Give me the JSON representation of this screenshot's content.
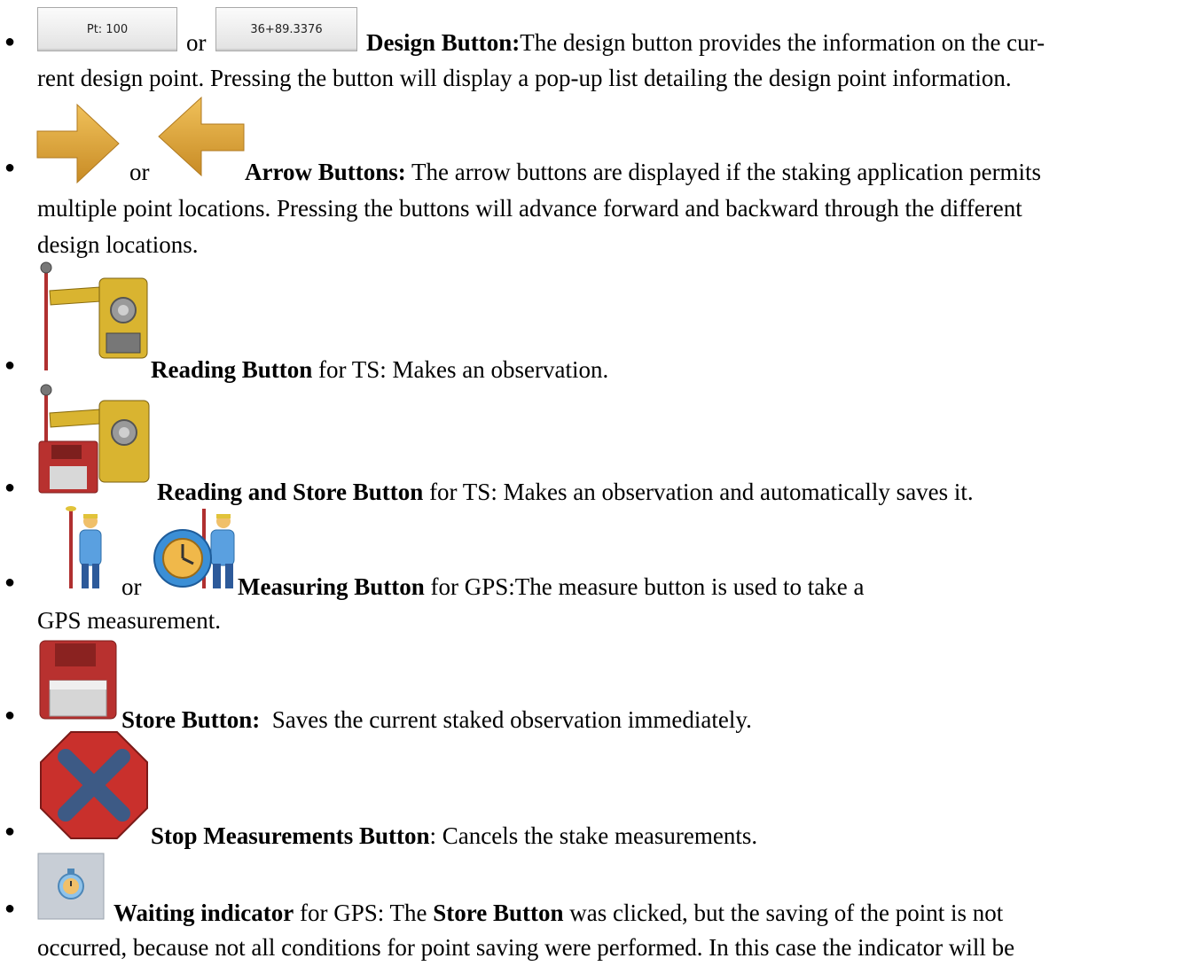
{
  "items": [
    {
      "btn1_label": "Pt: 100",
      "or": "or",
      "btn2_label": "36+89.3376",
      "title": "Design Button:",
      "desc_line1": "The design button provides the information on the cur-",
      "desc_line2": "rent design point. Pressing the button will display a pop-up list detailing the design point information.",
      "icons": [
        "design-button-pt",
        "design-button-station"
      ]
    },
    {
      "or": "or",
      "title": "Arrow Buttons:",
      "desc_line1": " The arrow buttons are displayed if the staking application permits",
      "desc_line2": "multiple point locations. Pressing the buttons will advance forward and backward through the different",
      "desc_line3": "design locations.",
      "icons": [
        "arrow-right-icon",
        "arrow-left-icon"
      ]
    },
    {
      "title": "Reading Button",
      "desc": " for TS: Makes an observation.",
      "icons": [
        "total-station-reading-icon"
      ]
    },
    {
      "title": "Reading and Store Button",
      "desc": " for TS: Makes an observation and automatically saves it.",
      "icons": [
        "total-station-store-icon"
      ]
    },
    {
      "or": "or",
      "title": "Measuring Button",
      "desc_line1": " for GPS:The measure button is used to take a",
      "desc_line2": "GPS measurement.",
      "icons": [
        "gps-surveyor-icon",
        "gps-timer-surveyor-icon"
      ]
    },
    {
      "title": "Store Button:",
      "desc": "  Saves the current staked observation immediately.",
      "icons": [
        "floppy-disk-icon"
      ]
    },
    {
      "title": "Stop Measurements Button",
      "desc": ": Cancels the stake measurements.",
      "icons": [
        "stop-x-icon"
      ]
    },
    {
      "title": "Waiting indicator",
      "desc_a": " for GPS: The ",
      "inline_bold": "Store Button",
      "desc_b": " was clicked, but the saving of the point is not",
      "desc_line2": "occurred, because not all conditions for point saving were performed. In this case the indicator will be",
      "icons": [
        "waiting-clock-icon"
      ]
    }
  ],
  "colors": {
    "arrow": "#d9a33a",
    "disk": "#b8312f",
    "stop": "#c9302c",
    "instrument": "#d9b430"
  }
}
